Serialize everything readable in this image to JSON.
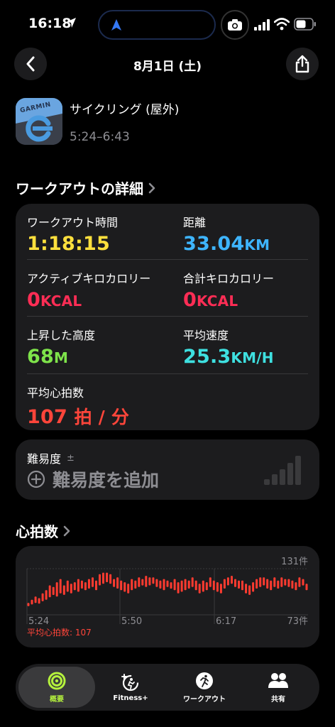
{
  "status_bar": {
    "time": "16:18"
  },
  "nav": {
    "title": "8月1日 (土)"
  },
  "workout": {
    "name": "サイクリング (屋外)",
    "time_range": "5:24–6:43",
    "app_icon_text": "GARMIN"
  },
  "details": {
    "section_title": "ワークアウトの詳細",
    "items": [
      {
        "label": "ワークアウト時間",
        "value": "1:18:15",
        "unit": "",
        "color": "#ffe03d"
      },
      {
        "label": "距離",
        "value": "33.04",
        "unit": "KM",
        "color": "#3eb5ff"
      },
      {
        "label": "アクティブキロカロリー",
        "value": "0",
        "unit": "KCAL",
        "color": "#ff2d55"
      },
      {
        "label": "合計キロカロリー",
        "value": "0",
        "unit": "KCAL",
        "color": "#ff2d55"
      },
      {
        "label": "上昇した高度",
        "value": "68",
        "unit": "M",
        "color": "#7ee34a"
      },
      {
        "label": "平均速度",
        "value": "25.3",
        "unit": "KM/H",
        "color": "#3ee0e0"
      },
      {
        "label": "平均心拍数",
        "value": "107",
        "unit": "拍 / 分",
        "color": "#ff453a"
      }
    ]
  },
  "difficulty": {
    "label": "難易度",
    "plus_minus": "±",
    "add_label": "難易度を追加"
  },
  "heart_rate": {
    "section_title": "心拍数",
    "max_label": "131件",
    "min_label": "73件",
    "avg_label": "平均心拍数: 107",
    "x_ticks": [
      "5:24",
      "5:50",
      "6:17"
    ]
  },
  "chart_data": {
    "type": "bar",
    "title": "",
    "xlabel": "",
    "ylabel": "",
    "ylim": [
      73,
      131
    ],
    "x_ticks": [
      "5:24",
      "5:50",
      "6:17"
    ],
    "series": [
      {
        "values": [
          [
            84,
            88
          ],
          [
            86,
            92
          ],
          [
            88,
            96
          ],
          [
            87,
            94
          ],
          [
            90,
            100
          ],
          [
            92,
            104
          ],
          [
            95,
            110
          ],
          [
            98,
            108
          ],
          [
            96,
            114
          ],
          [
            100,
            118
          ],
          [
            98,
            110
          ],
          [
            102,
            116
          ],
          [
            100,
            112
          ],
          [
            104,
            114
          ],
          [
            102,
            118
          ],
          [
            106,
            116
          ],
          [
            104,
            114
          ],
          [
            106,
            118
          ],
          [
            108,
            120
          ],
          [
            104,
            116
          ],
          [
            110,
            124
          ],
          [
            112,
            126
          ],
          [
            114,
            126
          ],
          [
            112,
            124
          ],
          [
            108,
            118
          ],
          [
            106,
            120
          ],
          [
            104,
            116
          ],
          [
            102,
            114
          ],
          [
            100,
            112
          ],
          [
            104,
            118
          ],
          [
            106,
            116
          ],
          [
            108,
            120
          ],
          [
            110,
            118
          ],
          [
            108,
            122
          ],
          [
            110,
            120
          ],
          [
            112,
            120
          ],
          [
            108,
            118
          ],
          [
            106,
            116
          ],
          [
            104,
            118
          ],
          [
            108,
            116
          ],
          [
            106,
            114
          ],
          [
            104,
            118
          ],
          [
            100,
            114
          ],
          [
            102,
            116
          ],
          [
            104,
            118
          ],
          [
            106,
            116
          ],
          [
            108,
            120
          ],
          [
            104,
            116
          ],
          [
            100,
            112
          ],
          [
            102,
            116
          ],
          [
            104,
            114
          ],
          [
            108,
            120
          ],
          [
            104,
            116
          ],
          [
            102,
            114
          ],
          [
            100,
            112
          ],
          [
            106,
            118
          ],
          [
            110,
            120
          ],
          [
            112,
            122
          ],
          [
            108,
            118
          ],
          [
            106,
            116
          ],
          [
            104,
            116
          ],
          [
            100,
            112
          ],
          [
            98,
            110
          ],
          [
            102,
            114
          ],
          [
            106,
            118
          ],
          [
            108,
            120
          ],
          [
            110,
            120
          ],
          [
            106,
            118
          ],
          [
            104,
            116
          ],
          [
            108,
            120
          ],
          [
            106,
            116
          ],
          [
            108,
            120
          ],
          [
            110,
            118
          ],
          [
            108,
            118
          ],
          [
            106,
            116
          ],
          [
            104,
            114
          ],
          [
            108,
            120
          ],
          [
            110,
            118
          ],
          [
            104,
            112
          ]
        ]
      }
    ]
  },
  "tabs": [
    {
      "label": "概要",
      "active": true
    },
    {
      "label": "Fitness+",
      "active": false
    },
    {
      "label": "ワークアウト",
      "active": false
    },
    {
      "label": "共有",
      "active": false
    }
  ],
  "colors": {
    "accent": "#b5f23d",
    "chart": "#ff3b30",
    "card": "#1c1c1e"
  }
}
